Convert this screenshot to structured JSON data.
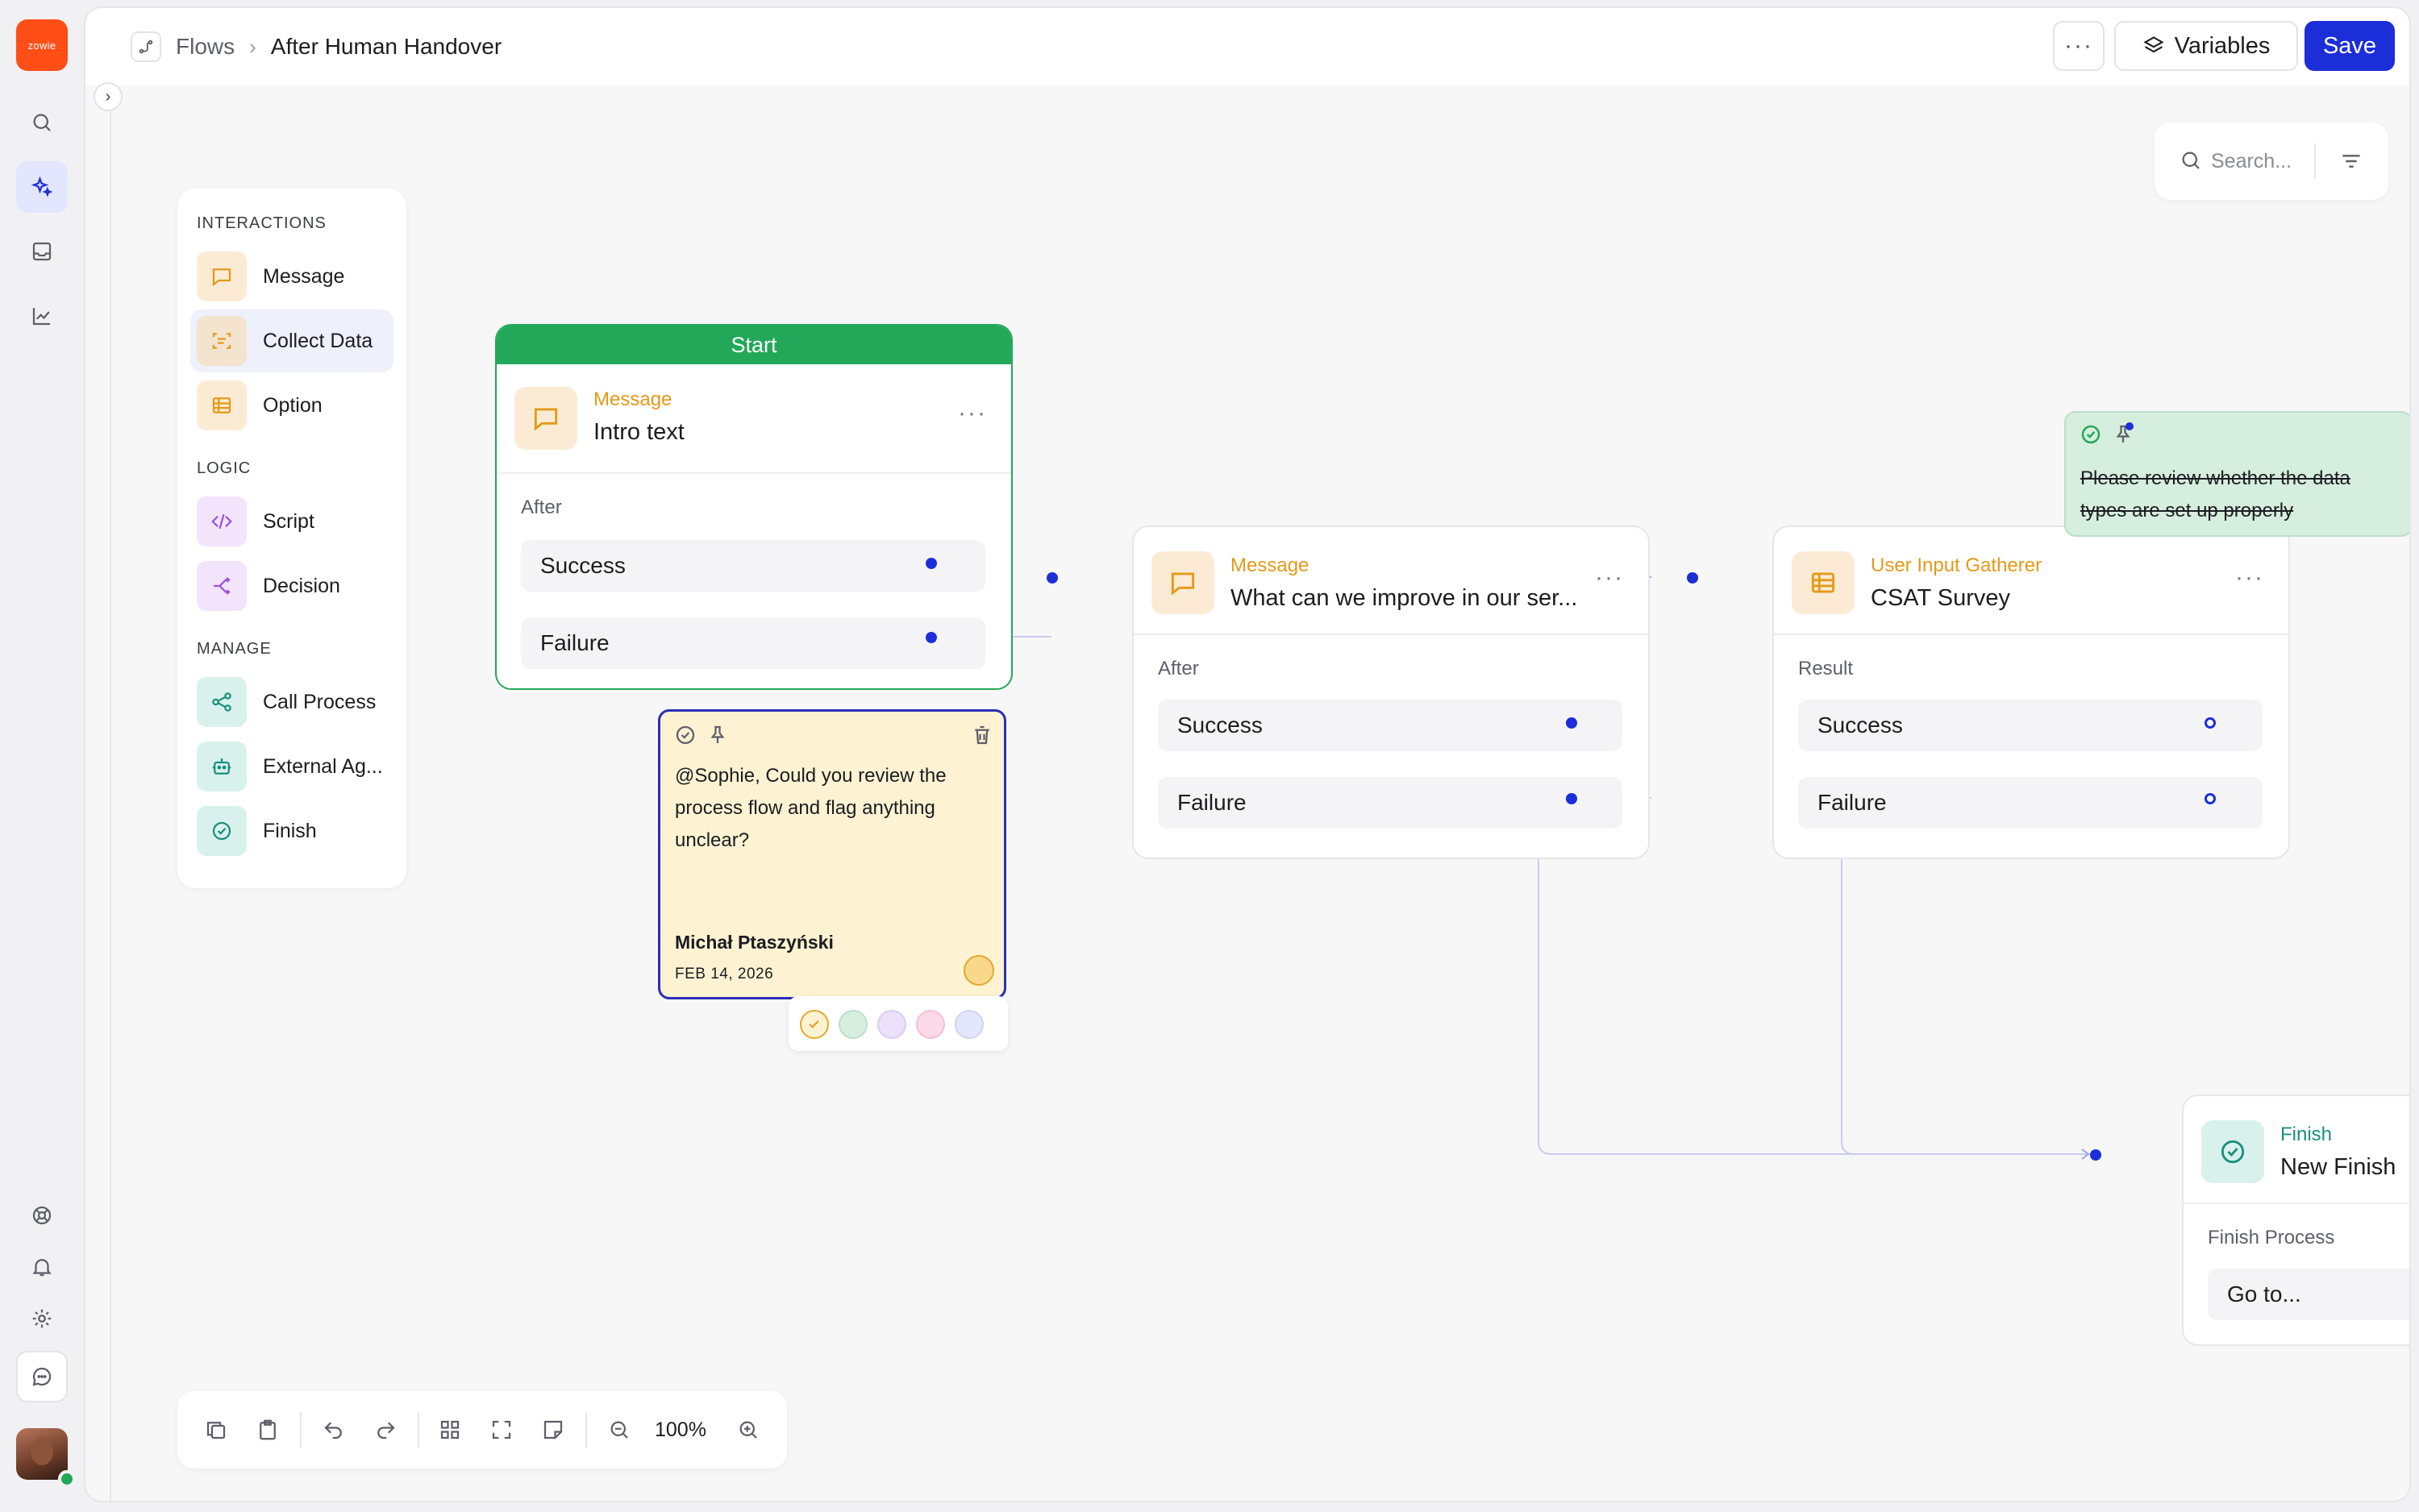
{
  "app": {
    "logo_text": "zowie",
    "accent": "#1c2ed8",
    "brand": "#ff4f17"
  },
  "leftnav": {
    "items": [
      "search",
      "ai-sparkle",
      "inbox",
      "analytics"
    ],
    "bottom": [
      "help",
      "notifications",
      "settings",
      "chat"
    ]
  },
  "header": {
    "breadcrumb_root": "Flows",
    "breadcrumb_current": "After Human Handover",
    "more_label": "···",
    "variables_label": "Variables",
    "save_label": "Save"
  },
  "palette": {
    "interactions_title": "INTERACTIONS",
    "logic_title": "LOGIC",
    "manage_title": "MANAGE",
    "items": [
      {
        "label": "Message"
      },
      {
        "label": "Collect Data"
      },
      {
        "label": "Option"
      },
      {
        "label": "Script"
      },
      {
        "label": "Decision"
      },
      {
        "label": "Call Process"
      },
      {
        "label": "External Ag..."
      },
      {
        "label": "Finish"
      }
    ]
  },
  "search": {
    "placeholder": "Search..."
  },
  "nodes": {
    "start": {
      "banner": "Start",
      "type": "Message",
      "title": "Intro text",
      "section": "After",
      "rows": [
        "Success",
        "Failure"
      ]
    },
    "message2": {
      "type": "Message",
      "title": "What can we improve in our ser...",
      "section": "After",
      "rows": [
        "Success",
        "Failure"
      ]
    },
    "gatherer": {
      "type": "User Input Gatherer",
      "title": "CSAT Survey",
      "section": "Result",
      "rows": [
        "Success",
        "Failure"
      ]
    },
    "finish": {
      "type": "Finish",
      "title": "New Finish",
      "section": "Finish Process",
      "rows": [
        "Go to..."
      ]
    }
  },
  "notes": {
    "yellow": {
      "body_line1": "@Sophie, Could you review the",
      "body_line2": "process flow and flag anything",
      "body_line3": "unclear?",
      "author": "Michał Ptaszyński",
      "date": "FEB 14, 2026"
    },
    "green": {
      "body_line1": "Please review whether the data",
      "body_line2": "types are set up properly"
    },
    "swatch_colors": [
      "#fdf3d2",
      "#d6eedd",
      "#ede0fb",
      "#fcd9e8",
      "#e4e6fc"
    ]
  },
  "toolbar": {
    "zoom": "100%"
  },
  "more_dots": "···"
}
